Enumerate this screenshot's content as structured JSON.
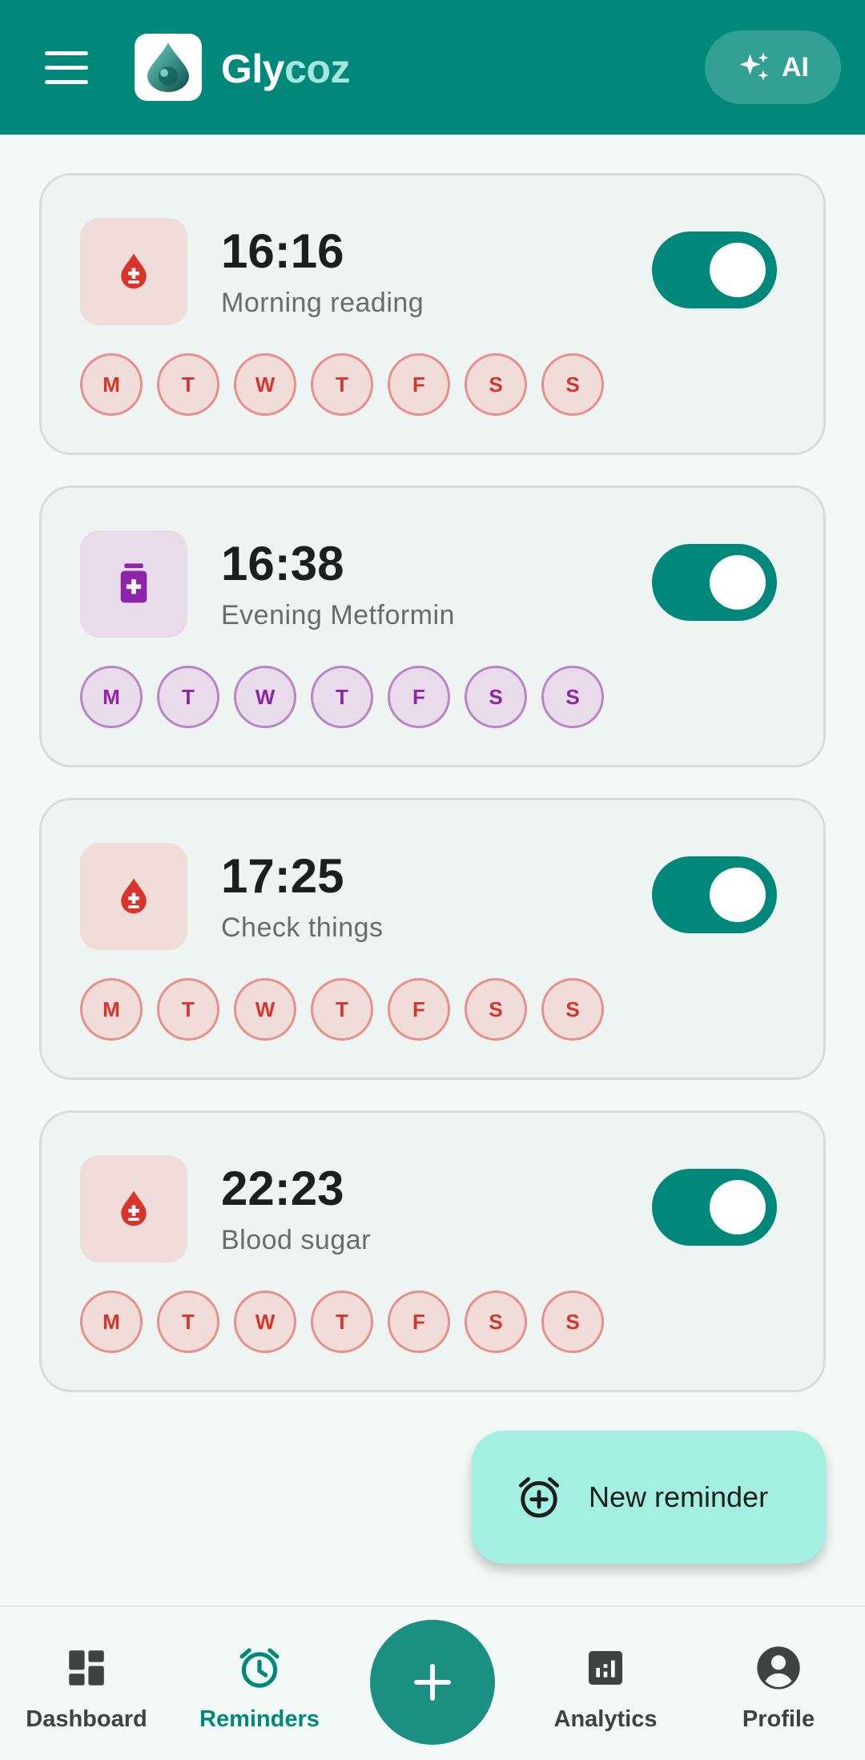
{
  "app": {
    "title_part1": "Gly",
    "title_part2": "coz",
    "ai_label": "AI",
    "header_color": "#00897b"
  },
  "reminders": [
    {
      "time": "16:16",
      "label": "Morning reading",
      "type": "blood-drop-icon",
      "enabled": true,
      "days": [
        "M",
        "T",
        "W",
        "T",
        "F",
        "S",
        "S"
      ]
    },
    {
      "time": "16:38",
      "label": "Evening Metformin",
      "type": "medication-icon",
      "enabled": true,
      "days": [
        "M",
        "T",
        "W",
        "T",
        "F",
        "S",
        "S"
      ]
    },
    {
      "time": "17:25",
      "label": "Check things",
      "type": "blood-drop-icon",
      "enabled": true,
      "days": [
        "M",
        "T",
        "W",
        "T",
        "F",
        "S",
        "S"
      ]
    },
    {
      "time": "22:23",
      "label": "Blood sugar",
      "type": "blood-drop-icon",
      "enabled": true,
      "days": [
        "M",
        "T",
        "W",
        "T",
        "F",
        "S",
        "S"
      ]
    }
  ],
  "fab": {
    "label": "New reminder",
    "icon": "alarm-add-icon"
  },
  "nav": {
    "items": [
      {
        "label": "Dashboard",
        "icon": "dashboard-icon"
      },
      {
        "label": "Reminders",
        "icon": "alarm-icon"
      },
      {
        "label": "Analytics",
        "icon": "analytics-icon"
      },
      {
        "label": "Profile",
        "icon": "account-circle-icon"
      }
    ],
    "active": "Reminders"
  },
  "colors": {
    "accent": "#00897b",
    "blood": "#d9342b",
    "medication": "#8e24aa",
    "fab": "#a3f0e2"
  }
}
